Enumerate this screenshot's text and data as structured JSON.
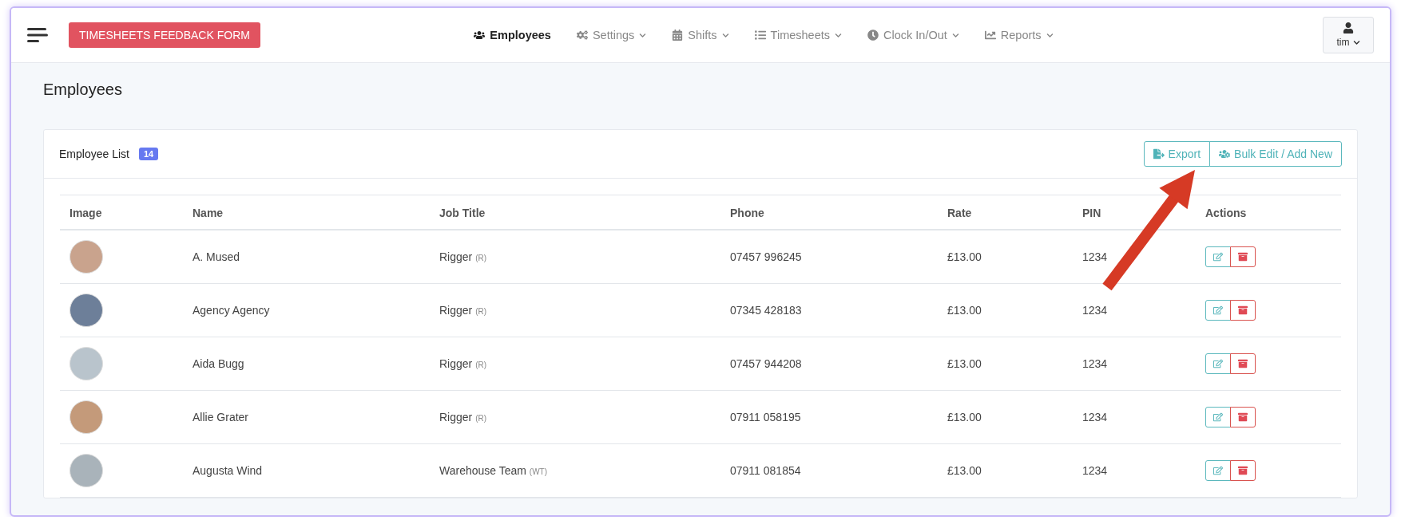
{
  "topbar": {
    "feedback_button": "TIMESHEETS FEEDBACK FORM",
    "nav": [
      {
        "kind": "users",
        "label": "Employees",
        "selected": true,
        "dropdown": false
      },
      {
        "kind": "cogs",
        "label": "Settings",
        "selected": false,
        "dropdown": true
      },
      {
        "kind": "calendar",
        "label": "Shifts",
        "selected": false,
        "dropdown": true
      },
      {
        "kind": "list",
        "label": "Timesheets",
        "selected": false,
        "dropdown": true
      },
      {
        "kind": "clock",
        "label": "Clock In/Out",
        "selected": false,
        "dropdown": true
      },
      {
        "kind": "chart",
        "label": "Reports",
        "selected": false,
        "dropdown": true
      }
    ],
    "user": "tim"
  },
  "page_title": "Employees",
  "card": {
    "title": "Employee List",
    "count": "14",
    "buttons": [
      {
        "kind": "export",
        "label": "Export"
      },
      {
        "kind": "bulk",
        "label": "Bulk Edit / Add New"
      }
    ]
  },
  "table": {
    "columns": [
      "Image",
      "Name",
      "Job Title",
      "Phone",
      "Rate",
      "PIN",
      "Actions"
    ],
    "rows": [
      {
        "name": "A. Mused",
        "job": "Rigger",
        "code": "(R)",
        "phone": "07457 996245",
        "rate": "£13.00",
        "pin": "1234"
      },
      {
        "name": "Agency Agency",
        "job": "Rigger",
        "code": "(R)",
        "phone": "07345 428183",
        "rate": "£13.00",
        "pin": "1234"
      },
      {
        "name": "Aida Bugg",
        "job": "Rigger",
        "code": "(R)",
        "phone": "07457 944208",
        "rate": "£13.00",
        "pin": "1234"
      },
      {
        "name": "Allie Grater",
        "job": "Rigger",
        "code": "(R)",
        "phone": "07911 058195",
        "rate": "£13.00",
        "pin": "1234"
      },
      {
        "name": "Augusta Wind",
        "job": "Warehouse Team",
        "code": "(WT)",
        "phone": "07911 081854",
        "rate": "£13.00",
        "pin": "1234"
      }
    ]
  }
}
